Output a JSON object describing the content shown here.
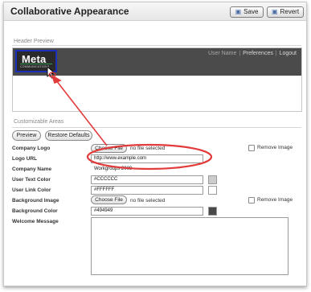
{
  "app": {
    "title": "Collaborative Appearance"
  },
  "toolbar": {
    "save_label": "Save",
    "save_icon": "disk-icon",
    "revert_label": "Revert",
    "revert_icon": "revert-icon"
  },
  "header_preview": {
    "section_label": "Header Preview",
    "nav": {
      "user_name": "User Name",
      "separator": "|",
      "preferences": "Preferences",
      "logout": "Logout"
    },
    "logo": {
      "word": "Meta",
      "tagline": "COMMUNICATIONS"
    },
    "header_color": "#4b4b4b"
  },
  "customizable": {
    "section_label": "Customizable Areas",
    "preview_button": "Preview",
    "restore_button": "Restore Defaults",
    "fields": {
      "company_logo": {
        "label": "Company Logo",
        "button": "Choose File",
        "status": "no file selected",
        "remove_label": "Remove Image"
      },
      "logo_url": {
        "label": "Logo URL",
        "value": "http://www.example.com"
      },
      "company_name": {
        "label": "Company Name",
        "value": "Workgroups 2009"
      },
      "user_text_color": {
        "label": "User Text Color",
        "value": "#CCCCCC",
        "swatch": "#cccccc"
      },
      "user_link_color": {
        "label": "User Link Color",
        "value": "#FFFFFF",
        "swatch": "#ffffff"
      },
      "background_image": {
        "label": "Background Image",
        "button": "Choose File",
        "status": "no file selected",
        "remove_label": "Remove Image"
      },
      "background_color": {
        "label": "Background Color",
        "value": "#494949",
        "swatch": "#494949"
      },
      "welcome_message": {
        "label": "Welcome Message",
        "value": ""
      }
    }
  },
  "annotation_color": "#e23b3b"
}
